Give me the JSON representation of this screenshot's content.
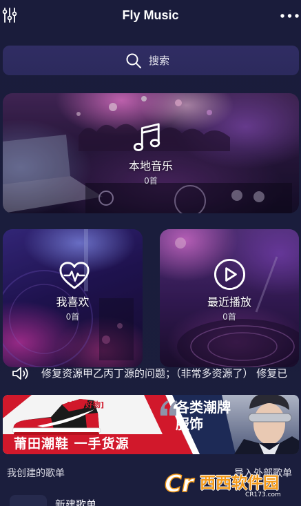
{
  "header": {
    "title": "Fly Music",
    "left_icon": "equalizer-icon",
    "right_icon": "more-dots-icon"
  },
  "search": {
    "label": "搜索",
    "icon": "search-icon"
  },
  "cards": {
    "local": {
      "title": "本地音乐",
      "count": "0首",
      "icon": "music-note-icon"
    },
    "favorites": {
      "title": "我喜欢",
      "count": "0首",
      "icon": "heart-pulse-icon"
    },
    "recent": {
      "title": "最近播放",
      "count": "0首",
      "icon": "play-circle-icon"
    }
  },
  "notice": {
    "icon": "speaker-icon",
    "text": "修复资源甲乙丙丁源的问题；（非常多资源了） 修复已"
  },
  "banner": {
    "tag": "[低价好物]",
    "slogan": "莆田潮鞋 一手货源",
    "headline_line1": "各类潮牌",
    "headline_line2": "服饰"
  },
  "playlists": {
    "section_title": "我创建的歌单",
    "import_label": "导入外部歌单",
    "items": [
      {
        "name": "新建歌单"
      }
    ]
  },
  "watermark": {
    "logo_mark": "Cr",
    "brand": "西西软件园",
    "site": "CR173.com"
  },
  "colors": {
    "background": "#1b1e3d",
    "search_bar": "#2c2a5d",
    "text_primary": "#ffffff",
    "text_secondary": "#d6d6e2",
    "banner_red": "#d1182b",
    "banner_navy": "#1d2a56",
    "watermark_orange": "#f39a1b"
  }
}
